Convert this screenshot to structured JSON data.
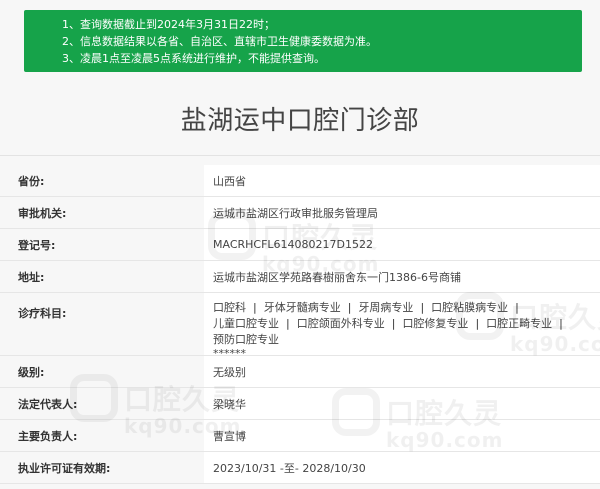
{
  "notice": {
    "lines": [
      "1、查询数据截止到2024年3月31日22时；",
      "2、信息数据结果以各省、自治区、直辖市卫生健康委数据为准。",
      "3、凌晨1点至凌晨5点系统进行维护，不能提供查询。"
    ]
  },
  "header": {
    "title": "盐湖运中口腔门诊部"
  },
  "details": [
    {
      "label": "省份:",
      "value": "山西省"
    },
    {
      "label": "审批机关:",
      "value": "运城市盐湖区行政审批服务管理局"
    },
    {
      "label": "登记号:",
      "value": "MACRHCFL614080217D1522"
    },
    {
      "label": "地址:",
      "value": "运城市盐湖区学苑路春樹丽舍东一门1386-6号商铺"
    },
    {
      "label": "诊疗科目:",
      "value_items": [
        "口腔科",
        "牙体牙髓病专业",
        "牙周病专业",
        "口腔粘膜病专业",
        "儿童口腔专业",
        "口腔颌面外科专业",
        "口腔修复专业",
        "口腔正畸专业",
        "预防口腔专业"
      ],
      "extra": "******"
    },
    {
      "label": "级别:",
      "value": "无级别"
    },
    {
      "label": "法定代表人:",
      "value": "梁晓华"
    },
    {
      "label": "主要负责人:",
      "value": "曹宣博"
    },
    {
      "label": "执业许可证有效期:",
      "value": "2023/10/31 -至- 2028/10/30"
    }
  ],
  "watermark": {
    "text_cn": "口腔久灵",
    "text_en": "kq90.com"
  },
  "colors": {
    "notice_bg": "#16a34a",
    "page_bg": "#f7f7f7"
  }
}
